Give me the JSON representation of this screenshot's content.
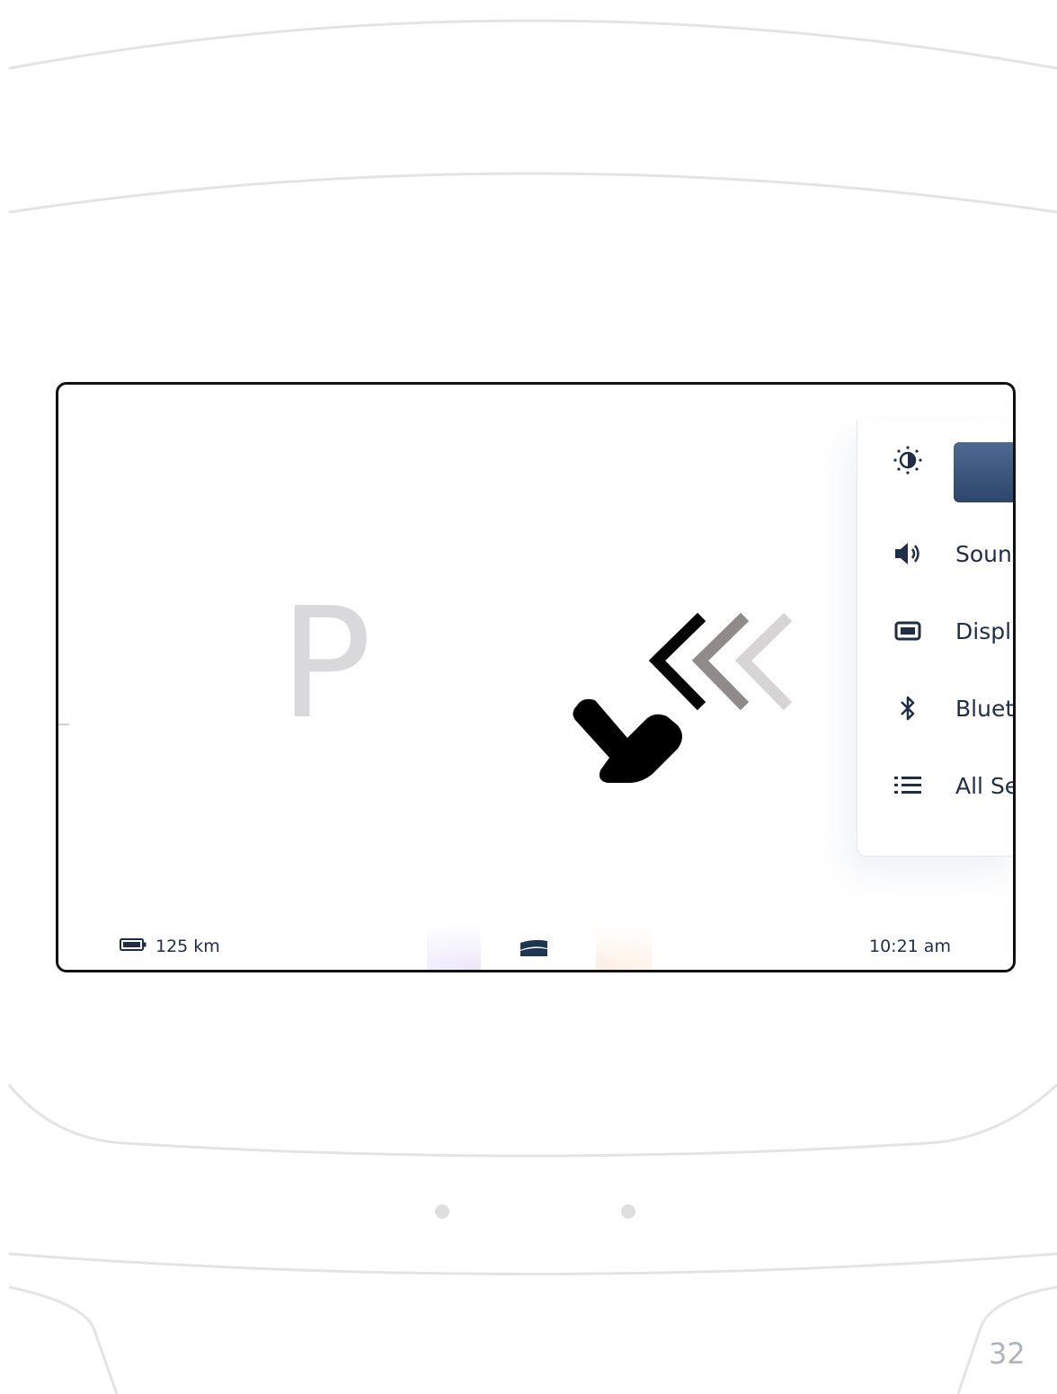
{
  "screen": {
    "gear_indicator": "P",
    "quick_settings": {
      "items": [
        {
          "icon": "brightness-icon",
          "label": ""
        },
        {
          "icon": "speaker-icon",
          "label": "Soun"
        },
        {
          "icon": "display-icon",
          "label": "Displ"
        },
        {
          "icon": "bluetooth-icon",
          "label": "Bluet"
        },
        {
          "icon": "list-icon",
          "label": "All Se"
        }
      ],
      "slider_color": "#2c466b"
    },
    "gesture": {
      "icon": "swipe-left-hand-icon",
      "direction": "left"
    },
    "status_bar": {
      "range": "125 km",
      "battery_icon": "battery-icon",
      "center_icon": "vehicle-icon",
      "time": "10:21 am"
    }
  },
  "page_number": "32",
  "colors": {
    "text": "#1f2d47",
    "accent": "#2c466b",
    "gear": "#d9d9db"
  }
}
